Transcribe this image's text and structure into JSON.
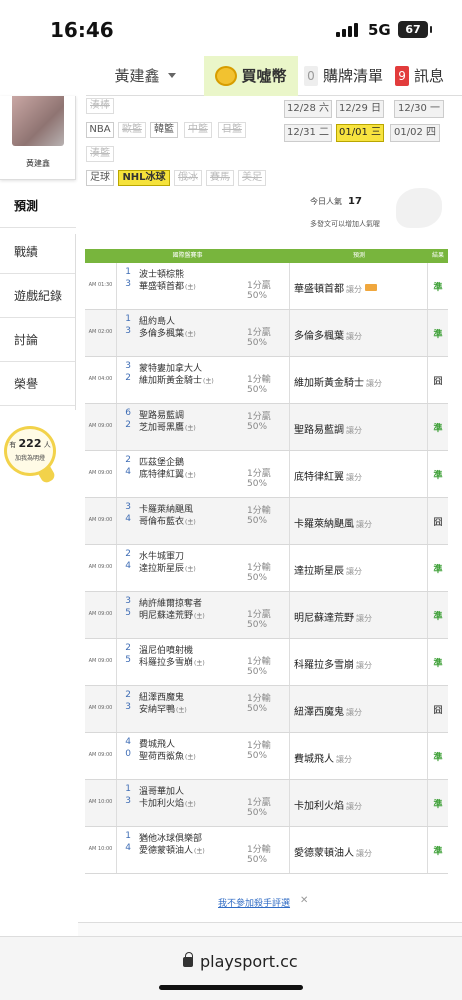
{
  "status_bar": {
    "time": "16:46",
    "network": "5G",
    "battery": "67"
  },
  "top_nav": {
    "user_name": "黃建鑫",
    "coin_label": "買噓幣",
    "cart_count": "0",
    "cart_label": "購牌清單",
    "msg_count": "9",
    "msg_label": "訊息"
  },
  "sidebar": {
    "avatar_name": "黃建鑫",
    "items": [
      "預測",
      "戰績",
      "遊戲紀錄",
      "討論",
      "榮譽"
    ],
    "bulb_prefix": "有",
    "bulb_count": "222",
    "bulb_suffix": "人",
    "bulb_caption": "加我為明燈"
  },
  "sports": [
    "湊棒",
    "NBA",
    "歐籃",
    "韓籃",
    "中籃",
    "日籃",
    "湊籃",
    "足球",
    "NHL冰球",
    "俄冰",
    "賽馬",
    "美足"
  ],
  "dates": [
    "12/28 六",
    "12/29 日",
    "12/30 一",
    "12/31 二",
    "01/01 三",
    "01/02 四"
  ],
  "popularity": {
    "label": "今日人氣",
    "value": "17",
    "tip": "多發文可以增加人氣喔"
  },
  "table": {
    "headers": [
      "國際盤賽事",
      "預測",
      "結果"
    ],
    "rows": [
      {
        "time": "AM 01:30",
        "s1": "1",
        "t1": "波士頓棕熊",
        "h1": "",
        "s2": "3",
        "t2": "華盛頓首都",
        "h2": "(主)",
        "line": "1分贏",
        "pct": "50%",
        "lineRow": "2",
        "pick": "華盛頓首都",
        "handi": "讓分",
        "flag": true,
        "result": "準",
        "win": true
      },
      {
        "time": "AM 02:00",
        "s1": "1",
        "t1": "紐約島人",
        "h1": "",
        "s2": "3",
        "t2": "多倫多楓葉",
        "h2": "(主)",
        "line": "1分贏",
        "pct": "50%",
        "lineRow": "2",
        "pick": "多倫多楓葉",
        "handi": "讓分",
        "flag": false,
        "result": "準",
        "win": true
      },
      {
        "time": "AM 04:00",
        "s1": "3",
        "t1": "蒙特婁加拿大人",
        "h1": "",
        "s2": "2",
        "t2": "維加斯黃金騎士",
        "h2": "(主)",
        "line": "1分輸",
        "pct": "50%",
        "lineRow": "2",
        "pick": "維加斯黃金騎士",
        "handi": "讓分",
        "flag": false,
        "result": "囧",
        "win": false
      },
      {
        "time": "AM 09:00",
        "s1": "6",
        "t1": "聖路易藍調",
        "h1": "",
        "s2": "2",
        "t2": "芝加哥黑鷹",
        "h2": "(主)",
        "line": "1分贏",
        "pct": "50%",
        "lineRow": "1",
        "pick": "聖路易藍調",
        "handi": "讓分",
        "flag": false,
        "result": "準",
        "win": true
      },
      {
        "time": "AM 09:00",
        "s1": "2",
        "t1": "匹茲堡企鵝",
        "h1": "",
        "s2": "4",
        "t2": "底特律紅翼",
        "h2": "(主)",
        "line": "1分贏",
        "pct": "50%",
        "lineRow": "2",
        "pick": "底特律紅翼",
        "handi": "讓分",
        "flag": false,
        "result": "準",
        "win": true
      },
      {
        "time": "AM 09:00",
        "s1": "3",
        "t1": "卡羅萊納颶風",
        "h1": "",
        "s2": "4",
        "t2": "哥倫布藍衣",
        "h2": "(主)",
        "line": "1分輸",
        "pct": "50%",
        "lineRow": "1",
        "pick": "卡羅萊納颶風",
        "handi": "讓分",
        "flag": false,
        "result": "囧",
        "win": false
      },
      {
        "time": "AM 09:00",
        "s1": "2",
        "t1": "水牛城軍刀",
        "h1": "",
        "s2": "4",
        "t2": "達拉斯星辰",
        "h2": "(主)",
        "line": "1分輸",
        "pct": "50%",
        "lineRow": "2",
        "pick": "達拉斯星辰",
        "handi": "讓分",
        "flag": false,
        "result": "準",
        "win": true
      },
      {
        "time": "AM 09:00",
        "s1": "3",
        "t1": "納許維爾掠奪者",
        "h1": "",
        "s2": "5",
        "t2": "明尼蘇達荒野",
        "h2": "(主)",
        "line": "1分贏",
        "pct": "50%",
        "lineRow": "2",
        "pick": "明尼蘇達荒野",
        "handi": "讓分",
        "flag": false,
        "result": "準",
        "win": true
      },
      {
        "time": "AM 09:00",
        "s1": "2",
        "t1": "溫尼伯噴射機",
        "h1": "",
        "s2": "5",
        "t2": "科羅拉多雪崩",
        "h2": "(主)",
        "line": "1分輸",
        "pct": "50%",
        "lineRow": "2",
        "pick": "科羅拉多雪崩",
        "handi": "讓分",
        "flag": false,
        "result": "準",
        "win": true
      },
      {
        "time": "AM 09:00",
        "s1": "2",
        "t1": "紐澤西魔鬼",
        "h1": "",
        "s2": "3",
        "t2": "安納罕鴨",
        "h2": "(主)",
        "line": "1分輸",
        "pct": "50%",
        "lineRow": "1",
        "pick": "紐澤西魔鬼",
        "handi": "讓分",
        "flag": false,
        "result": "囧",
        "win": false
      },
      {
        "time": "AM 09:00",
        "s1": "4",
        "t1": "費城飛人",
        "h1": "",
        "s2": "0",
        "t2": "聖荷西鯊魚",
        "h2": "(主)",
        "line": "1分輸",
        "pct": "50%",
        "lineRow": "1",
        "pick": "費城飛人",
        "handi": "讓分",
        "flag": false,
        "result": "準",
        "win": true
      },
      {
        "time": "AM 10:00",
        "s1": "1",
        "t1": "溫哥華加人",
        "h1": "",
        "s2": "3",
        "t2": "卡加利火焰",
        "h2": "(主)",
        "line": "1分贏",
        "pct": "50%",
        "lineRow": "2",
        "pick": "卡加利火焰",
        "handi": "讓分",
        "flag": false,
        "result": "準",
        "win": true
      },
      {
        "time": "AM 10:00",
        "s1": "1",
        "t1": "猶他冰球俱樂部",
        "h1": "",
        "s2": "4",
        "t2": "愛德蒙頓油人",
        "h2": "(主)",
        "line": "1分輸",
        "pct": "50%",
        "lineRow": "2",
        "pick": "愛德蒙頓油人",
        "handi": "讓分",
        "flag": false,
        "result": "準",
        "win": true
      }
    ]
  },
  "footer": {
    "no_join": "我不參加殺手評選",
    "close": "✕"
  },
  "browser": {
    "url": "playsport.cc"
  },
  "colors": {
    "table_header": "#78b53d",
    "win": "#3a9e33",
    "selected": "#f7e33f",
    "link": "#2f6bc4"
  }
}
